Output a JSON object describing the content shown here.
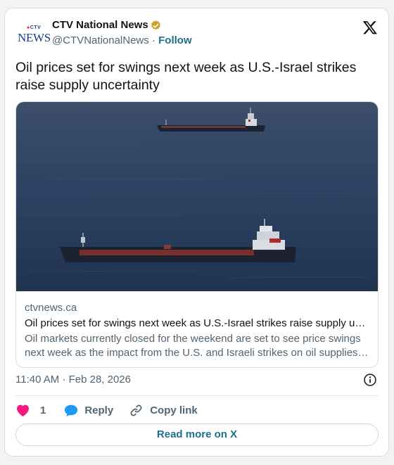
{
  "author": {
    "logo_top": "CTV",
    "logo_bottom": "NEWS",
    "name": "CTV National News",
    "handle": "@CTVNationalNews",
    "separator": "·",
    "follow_label": "Follow"
  },
  "tweet": {
    "text": "Oil prices set for swings next week as U.S.-Israel strikes raise supply uncertainty"
  },
  "link_card": {
    "domain": "ctvnews.ca",
    "title": "Oil prices set for swings next week as U.S.-Israel strikes raise supply u…",
    "description": "Oil markets currently closed for the weekend are set to see price swings next week as the impact from the U.S. and Israeli strikes on oil supplies…"
  },
  "meta": {
    "timestamp": "11:40 AM · Feb 28, 2026"
  },
  "actions": {
    "like_count": "1",
    "reply_label": "Reply",
    "copy_link_label": "Copy link"
  },
  "footer": {
    "read_more_label": "Read more on X"
  },
  "colors": {
    "like": "#f91880",
    "reply": "#1d9bf0",
    "follow": "#1d6f8d",
    "verified": "#c9a227"
  },
  "icons": [
    "verified-badge-icon",
    "x-logo-icon",
    "info-icon",
    "heart-icon",
    "reply-bubble-icon",
    "link-icon"
  ]
}
